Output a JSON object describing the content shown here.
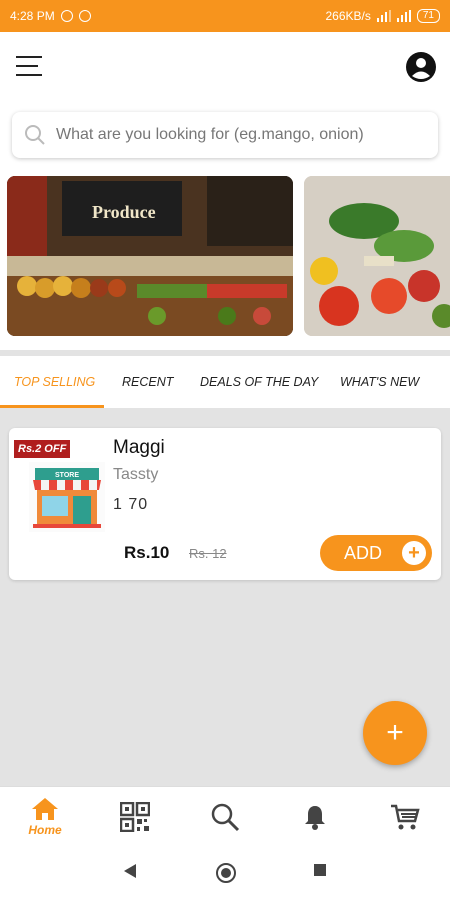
{
  "status_bar": {
    "time": "4:28 PM",
    "network_speed": "266KB/s",
    "battery": "71"
  },
  "search": {
    "placeholder": "What are you looking for (eg.mango, onion)"
  },
  "banners": {
    "banner1_sign": "Produce"
  },
  "tabs": [
    {
      "label": "TOP SELLING",
      "active": true
    },
    {
      "label": "RECENT",
      "active": false
    },
    {
      "label": "DEALS OF THE DAY",
      "active": false
    },
    {
      "label": "WHAT'S NEW",
      "active": false
    }
  ],
  "product": {
    "offer_badge": "Rs.2 OFF",
    "name": "Maggi",
    "description": "Tassty",
    "quantity": "1 70",
    "price": "Rs.10",
    "mrp": "Rs. 12",
    "add_label": "ADD",
    "image_label": "STORE"
  },
  "fab": {
    "icon": "plus-icon"
  },
  "bottom_nav": [
    {
      "icon": "home-icon",
      "label": "Home",
      "active": true
    },
    {
      "icon": "qr-code-icon",
      "label": "",
      "active": false
    },
    {
      "icon": "search-icon",
      "label": "",
      "active": false
    },
    {
      "icon": "bell-icon",
      "label": "",
      "active": false
    },
    {
      "icon": "cart-icon",
      "label": "",
      "active": false
    }
  ],
  "colors": {
    "accent": "#f7941d",
    "badge_red": "#b01e1e"
  }
}
